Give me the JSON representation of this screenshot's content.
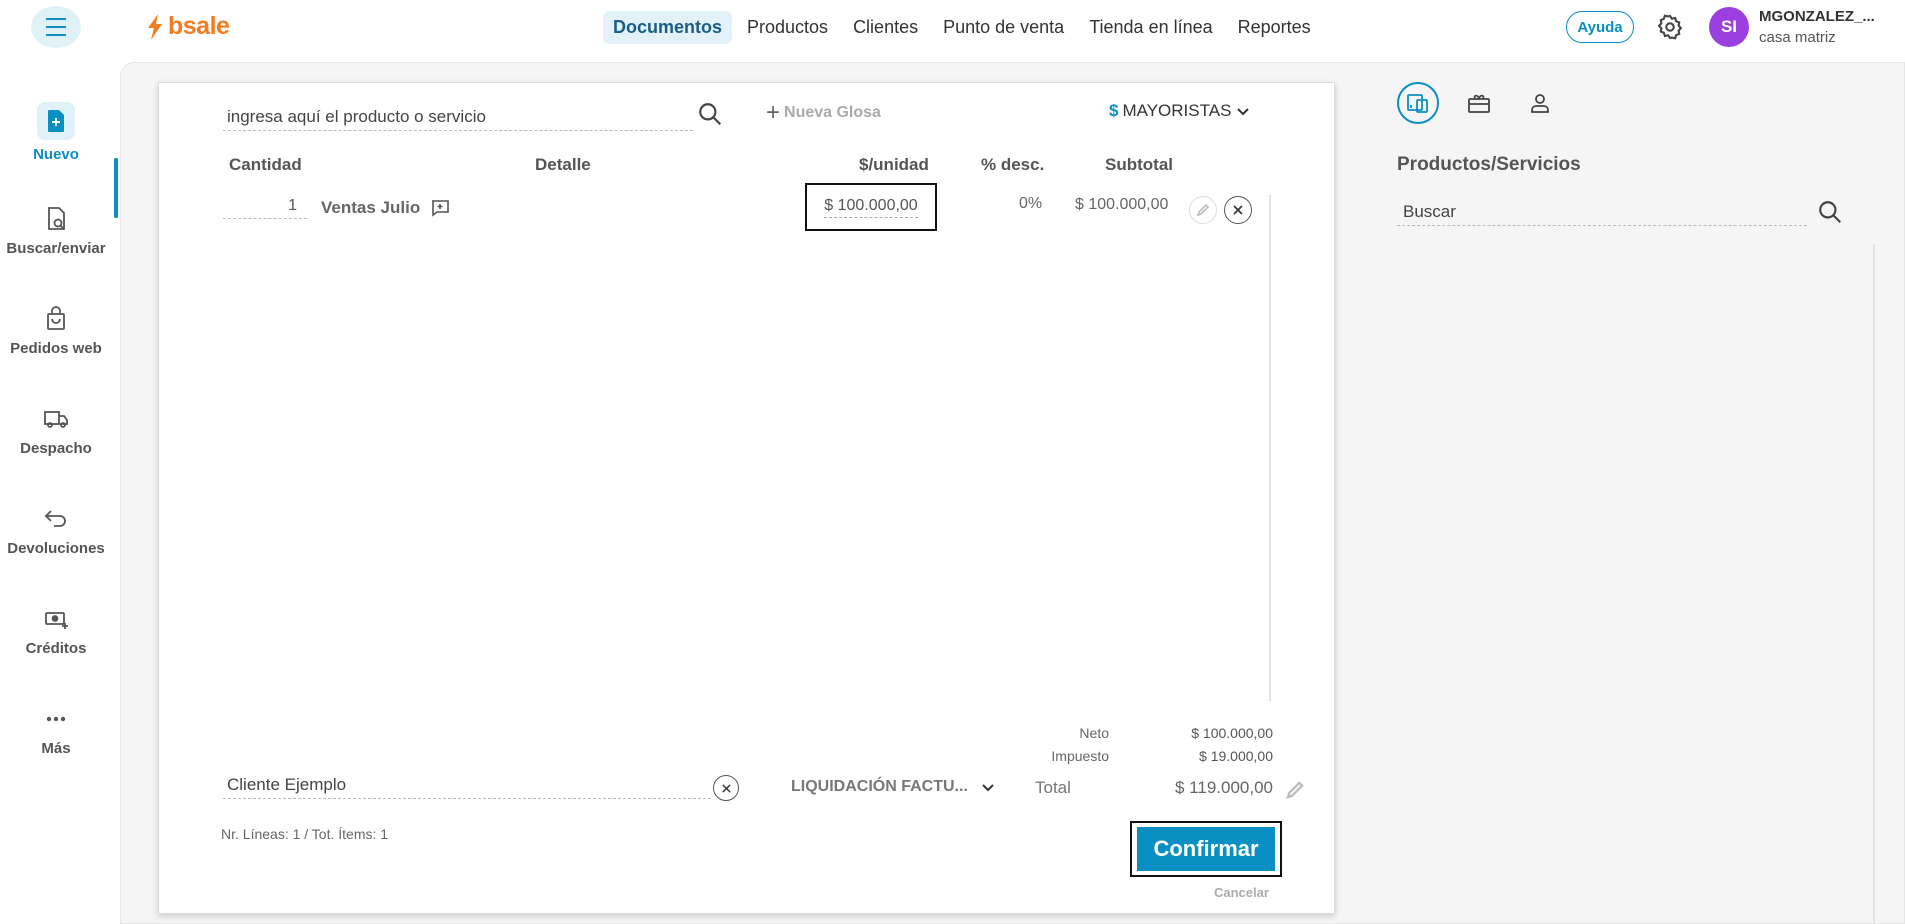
{
  "app": {
    "brand": "bsale"
  },
  "colors": {
    "accent": "#0a8fc2",
    "brand": "#f47c20",
    "avatar": "#9b3fe0"
  },
  "nav": {
    "items": [
      {
        "label": "Documentos",
        "active": true
      },
      {
        "label": "Productos"
      },
      {
        "label": "Clientes"
      },
      {
        "label": "Punto de venta"
      },
      {
        "label": "Tienda en línea"
      },
      {
        "label": "Reportes"
      }
    ]
  },
  "header": {
    "help_label": "Ayuda",
    "avatar_initials": "SI",
    "user_name": "MGONZALEZ_...",
    "user_branch": "casa matriz"
  },
  "sidebar": {
    "items": [
      {
        "label": "Nuevo",
        "icon": "new-document-icon"
      },
      {
        "label": "Buscar/enviar",
        "icon": "search-document-icon"
      },
      {
        "label": "Pedidos web",
        "icon": "shopping-bag-icon"
      },
      {
        "label": "Despacho",
        "icon": "truck-icon"
      },
      {
        "label": "Devoluciones",
        "icon": "return-arrow-icon"
      },
      {
        "label": "Créditos",
        "icon": "money-add-icon"
      },
      {
        "label": "Más",
        "icon": "more-dots-icon"
      }
    ]
  },
  "document": {
    "product_placeholder": "ingresa aquí el producto o servicio",
    "nueva_glosa": "Nueva Glosa",
    "price_list_symbol": "$",
    "price_list": "MAYORISTAS",
    "columns": {
      "cantidad": "Cantidad",
      "detalle": "Detalle",
      "unit_price": "$/unidad",
      "discount": "% desc.",
      "subtotal": "Subtotal"
    },
    "lines": [
      {
        "quantity": "1",
        "detail": "Ventas Julio",
        "unit_price": "$ 100.000,00",
        "discount": "0%",
        "subtotal": "$ 100.000,00"
      }
    ],
    "totals": {
      "neto_label": "Neto",
      "neto": "$ 100.000,00",
      "impuesto_label": "Impuesto",
      "impuesto": "$ 19.000,00",
      "total_label": "Total",
      "total": "$ 119.000,00"
    },
    "client": "Cliente Ejemplo",
    "doc_type": "LIQUIDACIÓN FACTU...",
    "lines_info": "Nr. Líneas: 1 / Tot. Ítems: 1",
    "confirm_label": "Confirmar",
    "cancel_label": "Cancelar"
  },
  "right_panel": {
    "title": "Productos/Servicios",
    "search_placeholder": "Buscar"
  }
}
